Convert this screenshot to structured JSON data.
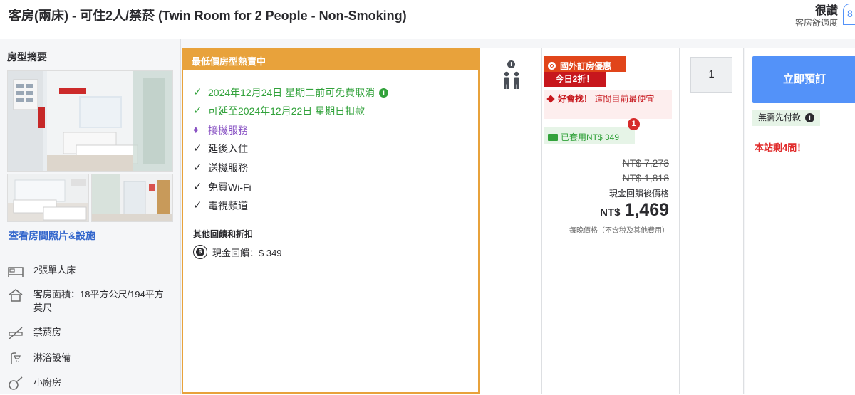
{
  "header": {
    "title": "客房(兩床) - 可住2人/禁菸 (Twin Room for 2 People - Non-Smoking)",
    "rating_word": "很讚",
    "rating_sub": "客房舒適度",
    "score": "8"
  },
  "left": {
    "summary_title": "房型摘要",
    "view_photos": "查看房間照片&設施",
    "features": [
      {
        "icon": "bed-icon",
        "text": "2張單人床"
      },
      {
        "icon": "house-icon",
        "text": "客房面積：18平方公尺/194平方英尺"
      },
      {
        "icon": "no-smoking-icon",
        "text": "禁菸房"
      },
      {
        "icon": "shower-icon",
        "text": "淋浴設備"
      },
      {
        "icon": "kitchen-icon",
        "text": "小廚房"
      }
    ]
  },
  "deal": {
    "header": "最低價房型熱賣中",
    "benefits": [
      {
        "mark": "✓",
        "text": "2024年12月24日 星期二前可免費取消",
        "style": "green",
        "info": true
      },
      {
        "mark": "✓",
        "text": "可延至2024年12月22日 星期日扣款",
        "style": "green",
        "info": false
      },
      {
        "mark": "♦",
        "text": "接機服務",
        "style": "purple",
        "info": false
      },
      {
        "mark": "✓",
        "text": "延後入住",
        "style": "dark",
        "info": false
      },
      {
        "mark": "✓",
        "text": "送機服務",
        "style": "dark",
        "info": false
      },
      {
        "mark": "✓",
        "text": "免費Wi-Fi",
        "style": "dark",
        "info": false
      },
      {
        "mark": "✓",
        "text": "電視頻道",
        "style": "dark",
        "info": false
      }
    ],
    "other_title": "其他回饋和折扣",
    "cashback": "現金回饋：$ 349"
  },
  "price": {
    "badge_promo": "國外訂房優惠",
    "badge_discount": "今日2折！",
    "deal_label": "好會找！",
    "deal_text": "這間目前最便宜",
    "applied": "已套用NT$ 349",
    "notif_count": "1",
    "original_price": "NT$ 7,273",
    "discounted_price": "NT$ 1,818",
    "after_cashback_label": "現金回饋後價格",
    "currency": "NT$",
    "final_price": "1,469",
    "per_night": "每晚價格（不含稅及其他費用）"
  },
  "qty": {
    "value": "1"
  },
  "book": {
    "button": "立即預訂",
    "no_prepay": "無需先付款",
    "rooms_left": "本站剩4間！"
  }
}
